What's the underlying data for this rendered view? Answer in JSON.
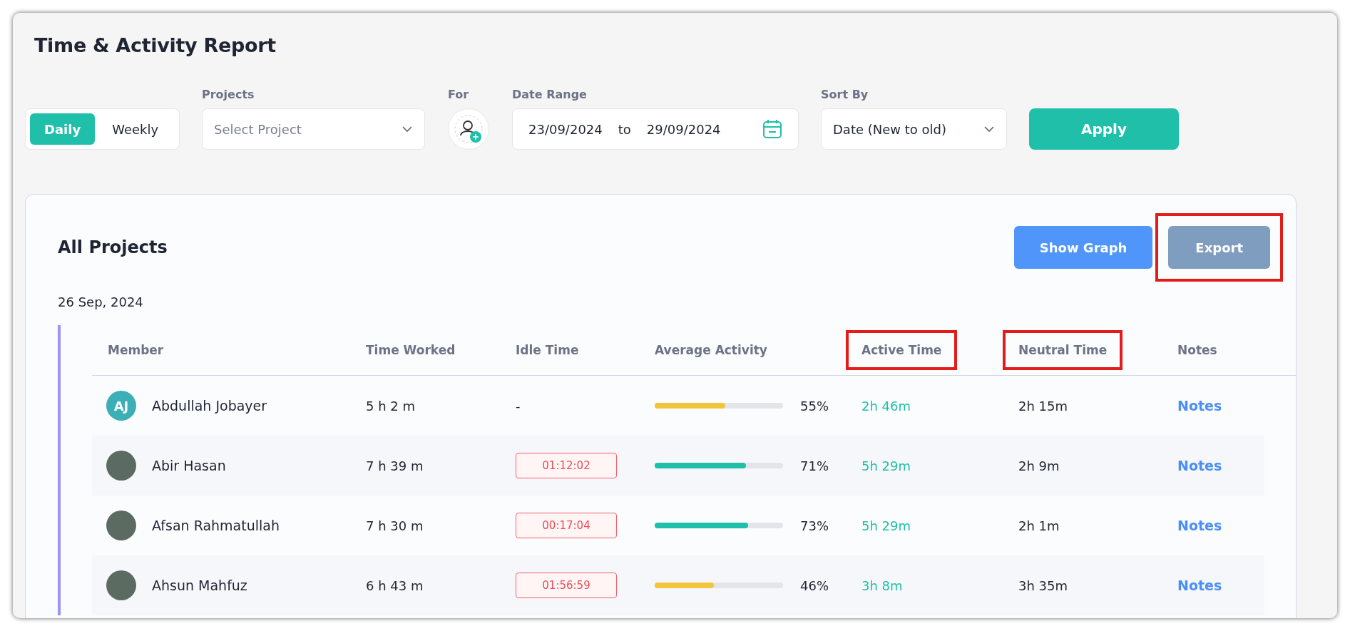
{
  "window": {
    "title": "Time & Activity Report"
  },
  "filters": {
    "period_tabs": [
      {
        "label": "Daily",
        "selected": true
      },
      {
        "label": "Weekly",
        "selected": false
      }
    ],
    "projects": {
      "label": "Projects",
      "placeholder": "Select Project"
    },
    "for": {
      "label": "For"
    },
    "date_range": {
      "label": "Date Range",
      "from": "23/09/2024",
      "separator": "to",
      "to": "29/09/2024"
    },
    "sort_by": {
      "label": "Sort By",
      "value": "Date (New to old)"
    },
    "apply_button": "Apply"
  },
  "report": {
    "title": "All Projects",
    "buttons": [
      {
        "label": "Show Graph",
        "kind": "primary",
        "highlighted": false
      },
      {
        "label": "Export",
        "kind": "muted",
        "highlighted": true
      }
    ],
    "date": "26 Sep, 2024",
    "columns": [
      {
        "label": "Member",
        "highlighted": false
      },
      {
        "label": "Time Worked",
        "highlighted": false
      },
      {
        "label": "Idle Time",
        "highlighted": false
      },
      {
        "label": "Average Activity",
        "highlighted": false
      },
      {
        "label": "Active Time",
        "highlighted": true
      },
      {
        "label": "Neutral Time",
        "highlighted": true
      },
      {
        "label": "Notes",
        "highlighted": false
      }
    ],
    "rows": [
      {
        "avatar": {
          "kind": "initials",
          "text": "AJ"
        },
        "member": "Abdullah Jobayer",
        "time_worked": "5 h 2 m",
        "idle": {
          "kind": "none",
          "text": "-"
        },
        "activity": {
          "level": 0.55,
          "color": "#f2c53d",
          "reading": "55%"
        },
        "active_time": "2h 46m",
        "neutral_time": "2h 15m",
        "notes": "Notes"
      },
      {
        "avatar": {
          "kind": "photo"
        },
        "member": "Abir Hasan",
        "time_worked": "7 h 39 m",
        "idle": {
          "kind": "flagged",
          "text": "01:12:02"
        },
        "activity": {
          "level": 0.71,
          "color": "#20bfa9",
          "reading": "71%"
        },
        "active_time": "5h 29m",
        "neutral_time": "2h 9m",
        "notes": "Notes"
      },
      {
        "avatar": {
          "kind": "photo"
        },
        "member": "Afsan Rahmatullah",
        "time_worked": "7 h 30 m",
        "idle": {
          "kind": "flagged",
          "text": "00:17:04"
        },
        "activity": {
          "level": 0.73,
          "color": "#20bfa9",
          "reading": "73%"
        },
        "active_time": "5h 29m",
        "neutral_time": "2h 1m",
        "notes": "Notes"
      },
      {
        "avatar": {
          "kind": "photo"
        },
        "member": "Ahsun Mahfuz",
        "time_worked": "6 h 43 m",
        "idle": {
          "kind": "flagged",
          "text": "01:56:59"
        },
        "activity": {
          "level": 0.46,
          "color": "#f2c53d",
          "reading": "46%"
        },
        "active_time": "3h 8m",
        "neutral_time": "3h 35m",
        "notes": "Notes"
      }
    ]
  }
}
